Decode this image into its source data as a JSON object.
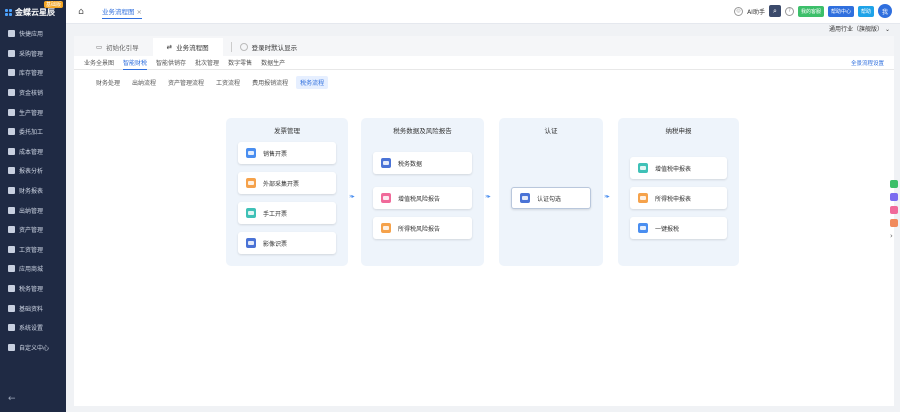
{
  "app": {
    "logo_text": "金蝶云星辰",
    "logo_badge": "基础版"
  },
  "sidebar": {
    "items": [
      {
        "label": "快捷应用",
        "icon": "grid-icon"
      },
      {
        "label": "采购管理",
        "icon": "cart-icon"
      },
      {
        "label": "库存管理",
        "icon": "box-icon"
      },
      {
        "label": "资金核销",
        "icon": "coin-icon"
      },
      {
        "label": "生产管理",
        "icon": "factory-icon"
      },
      {
        "label": "委托加工",
        "icon": "tool-icon"
      },
      {
        "label": "成本管理",
        "icon": "chart-icon"
      },
      {
        "label": "报表分析",
        "icon": "report-icon"
      },
      {
        "label": "财务报表",
        "icon": "finance-icon"
      },
      {
        "label": "出纳管理",
        "icon": "cashier-icon"
      },
      {
        "label": "资产管理",
        "icon": "asset-icon"
      },
      {
        "label": "工资管理",
        "icon": "salary-icon"
      },
      {
        "label": "应用商城",
        "icon": "store-icon"
      },
      {
        "label": "税务管理",
        "icon": "tax-icon"
      },
      {
        "label": "基础资料",
        "icon": "data-icon"
      },
      {
        "label": "系统设置",
        "icon": "settings-icon"
      },
      {
        "label": "自定义中心",
        "icon": "custom-icon"
      }
    ],
    "collapse": "←"
  },
  "topbar": {
    "home_icon": "⌂",
    "tab_label": "业务流程图",
    "tab_close": "×",
    "user": "AI助手",
    "pill_green": "我的客服",
    "pill_blue": "帮助中心",
    "pill_cyan": "帮助",
    "avatar": "我",
    "industry": "通用行业（旗舰版）"
  },
  "guide": {
    "tabs": [
      "初始化引导",
      "业务流程图"
    ],
    "default_show": "登录时默认显示"
  },
  "subtabs": {
    "items": [
      "业务全景图",
      "智能财税",
      "智能供销存",
      "批次管理",
      "数字零售",
      "数据生产"
    ],
    "active_index": 1,
    "all_link": "全景流程设置"
  },
  "thirdtabs": {
    "items": [
      "财务处理",
      "出纳流程",
      "资产管理流程",
      "工资流程",
      "费用报销流程",
      "税务流程"
    ],
    "active_index": 5
  },
  "flow": {
    "columns": [
      {
        "title": "发票管理",
        "cards": [
          "销售开票",
          "外部采集开票",
          "手工开票",
          "影像识票"
        ]
      },
      {
        "title": "税务数据及风险报告",
        "cards": [
          "税务数据",
          "增值税风险报告",
          "所得税风险报告"
        ]
      },
      {
        "title": "认证",
        "cards": [
          "认证勾选"
        ]
      },
      {
        "title": "纳税申报",
        "cards": [
          "增值税申报表",
          "所得税申报表",
          "一键报税"
        ]
      }
    ],
    "arrow": "»▸",
    "colors": {
      "blue": "#4a8ef0",
      "orange": "#f5a24b",
      "teal": "#3fc1b7",
      "pink": "#f06a9a",
      "navy": "#4a73d6",
      "column_bg": "#eef4fb",
      "accent": "#2f6fde"
    }
  },
  "floaters": {
    "chevron": "›"
  }
}
